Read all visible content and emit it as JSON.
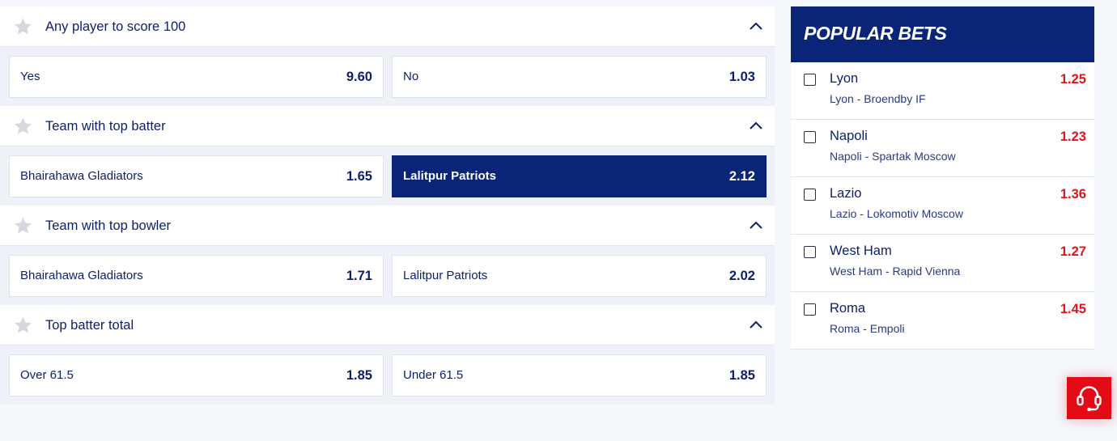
{
  "markets": [
    {
      "title": "Any player to score 100",
      "outcomes": [
        {
          "name": "Yes",
          "odd": "9.60",
          "selected": false
        },
        {
          "name": "No",
          "odd": "1.03",
          "selected": false
        }
      ]
    },
    {
      "title": "Team with top batter",
      "outcomes": [
        {
          "name": "Bhairahawa Gladiators",
          "odd": "1.65",
          "selected": false
        },
        {
          "name": "Lalitpur Patriots",
          "odd": "2.12",
          "selected": true
        }
      ]
    },
    {
      "title": "Team with top bowler",
      "outcomes": [
        {
          "name": "Bhairahawa Gladiators",
          "odd": "1.71",
          "selected": false
        },
        {
          "name": "Lalitpur Patriots",
          "odd": "2.02",
          "selected": false
        }
      ]
    },
    {
      "title": "Top batter total",
      "outcomes": [
        {
          "name": "Over 61.5",
          "odd": "1.85",
          "selected": false
        },
        {
          "name": "Under 61.5",
          "odd": "1.85",
          "selected": false
        }
      ]
    }
  ],
  "popular": {
    "title": "POPULAR BETS",
    "items": [
      {
        "team": "Lyon",
        "match": "Lyon  -  Broendby IF",
        "odd": "1.25"
      },
      {
        "team": "Napoli",
        "match": "Napoli  -  Spartak Moscow",
        "odd": "1.23"
      },
      {
        "team": "Lazio",
        "match": "Lazio  -  Lokomotiv Moscow",
        "odd": "1.36"
      },
      {
        "team": "West Ham",
        "match": "West Ham  -  Rapid Vienna",
        "odd": "1.27"
      },
      {
        "team": "Roma",
        "match": "Roma  -  Empoli",
        "odd": "1.45"
      }
    ]
  },
  "icons": {
    "favorite": "star-icon",
    "collapse": "chevron-up-icon",
    "support": "headset-icon"
  },
  "colors": {
    "brand": "#0a2478",
    "odd_highlight": "#e1141b",
    "support": "#e40b17"
  }
}
